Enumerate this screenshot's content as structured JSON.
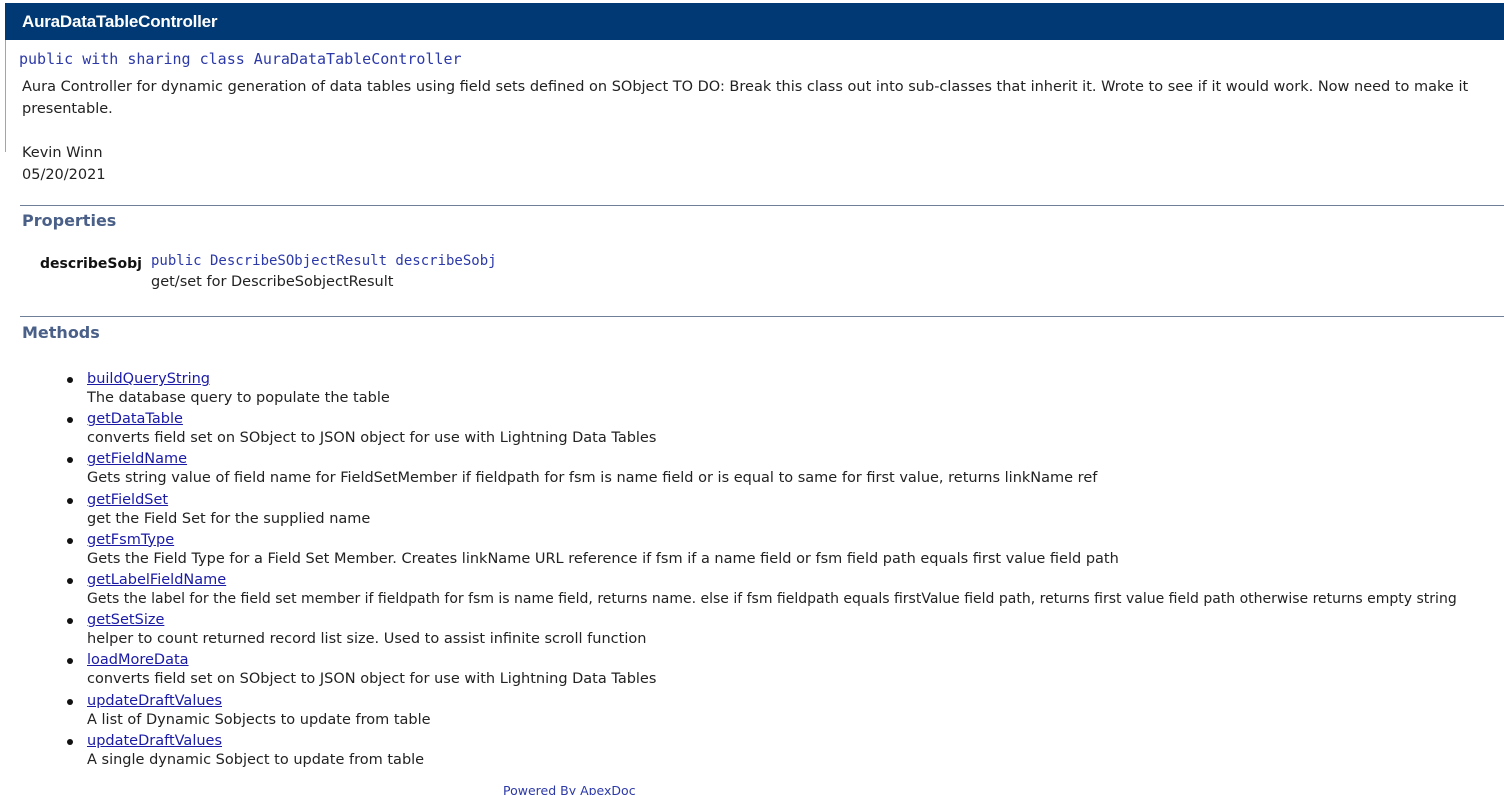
{
  "header": {
    "title": "AuraDataTableController"
  },
  "class_info": {
    "signature": "public with sharing class AuraDataTableController",
    "description": "Aura Controller for dynamic generation of data tables using field sets defined on SObject TO DO: Break this class out into sub-classes that inherit it. Wrote to see if it would work. Now need to make it presentable.",
    "author": "Kevin Winn",
    "date": "05/20/2021"
  },
  "properties": {
    "title": "Properties",
    "items": [
      {
        "name": "describeSobj",
        "signature": "public DescribeSObjectResult describeSobj",
        "description": "get/set for DescribeSobjectResult"
      }
    ]
  },
  "methods": {
    "title": "Methods",
    "items": [
      {
        "name": "buildQueryString",
        "description": "The database query to populate the table"
      },
      {
        "name": "getDataTable",
        "description": "converts field set on SObject to JSON object for use with Lightning Data Tables"
      },
      {
        "name": "getFieldName",
        "description": "Gets string value of field name for FieldSetMember if fieldpath for fsm is name field or is equal to same for first value, returns linkName ref"
      },
      {
        "name": "getFieldSet",
        "description": "get the Field Set for the supplied name"
      },
      {
        "name": "getFsmType",
        "description": "Gets the Field Type for a Field Set Member. Creates linkName URL reference if fsm if a name field or fsm field path equals first value field path"
      },
      {
        "name": "getLabelFieldName",
        "description": "Gets the label for the field set member if fieldpath for fsm is name field, returns name. else if fsm fieldpath equals firstValue field path, returns first value field path otherwise returns empty string"
      },
      {
        "name": "getSetSize",
        "description": "helper to count returned record list size. Used to assist infinite scroll function"
      },
      {
        "name": "loadMoreData",
        "description": "converts field set on SObject to JSON object for use with Lightning Data Tables"
      },
      {
        "name": "updateDraftValues",
        "description": "A list of Dynamic Sobjects to update from table"
      },
      {
        "name": "updateDraftValues",
        "description": "A single dynamic Sobject to update from table"
      }
    ]
  },
  "footer": {
    "text": "Powered By ApexDoc"
  },
  "colors": {
    "header_bg": "#003973",
    "section_title": "#4a6088",
    "code": "#2c39a8",
    "link": "#1a1aa6"
  }
}
